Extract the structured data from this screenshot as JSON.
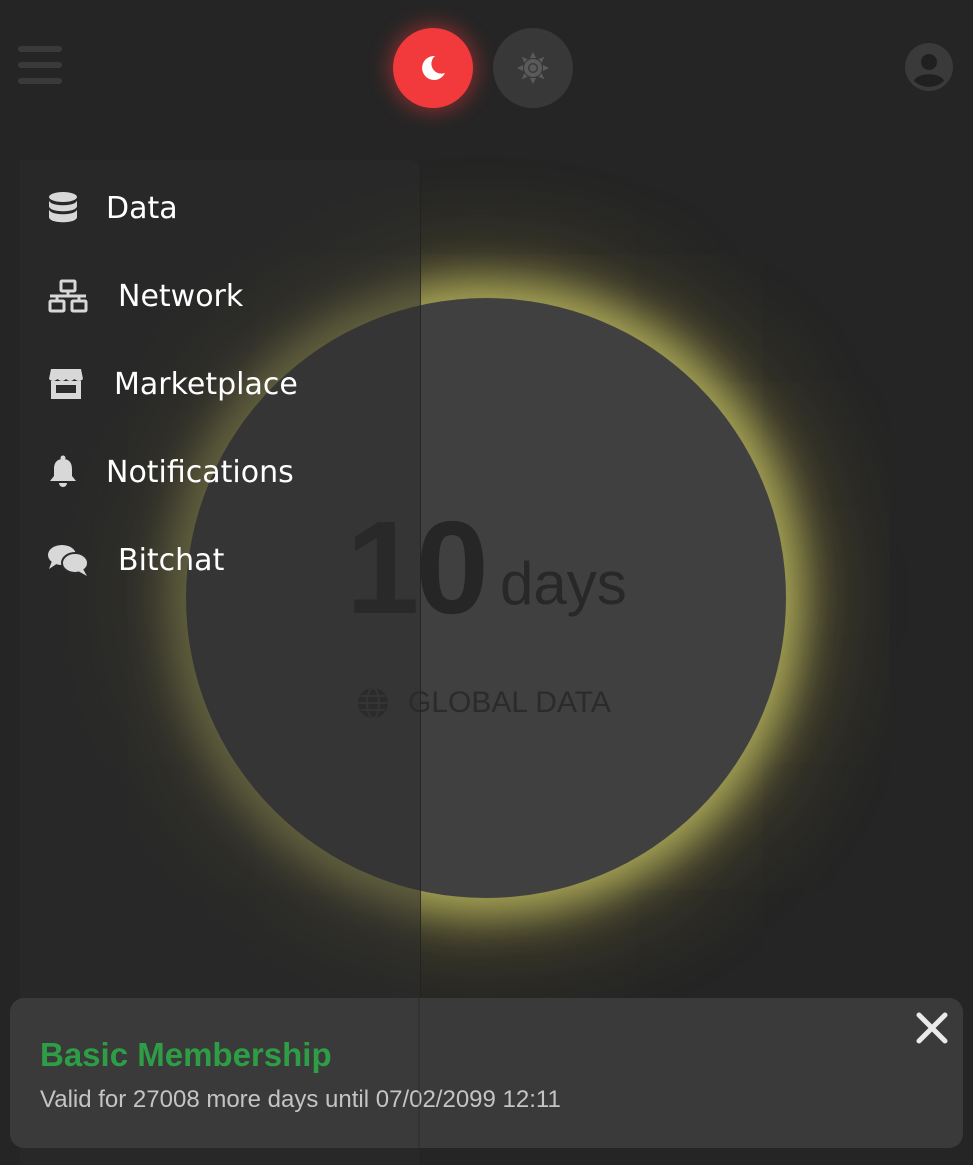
{
  "header": {
    "menu_icon": "hamburger-icon",
    "theme_dark_icon": "moon-icon",
    "theme_light_icon": "sun-icon",
    "profile_icon": "user-icon",
    "accent_color": "#f23a3c"
  },
  "counter": {
    "value": "10",
    "unit": "days",
    "caption": "GLOBAL DATA",
    "caption_icon": "globe-icon",
    "glow_color": "#c8c464"
  },
  "sidebar": {
    "items": [
      {
        "label": "Data",
        "icon": "database-icon"
      },
      {
        "label": "Network",
        "icon": "network-icon"
      },
      {
        "label": "Marketplace",
        "icon": "store-icon"
      },
      {
        "label": "Notifications",
        "icon": "bell-icon"
      },
      {
        "label": "Bitchat",
        "icon": "chat-bubbles-icon"
      }
    ]
  },
  "membership": {
    "title": "Basic Membership",
    "detail": "Valid for 27008 more days until 07/02/2099 12:11",
    "title_color": "#2e9e46",
    "close_icon": "close-icon"
  }
}
